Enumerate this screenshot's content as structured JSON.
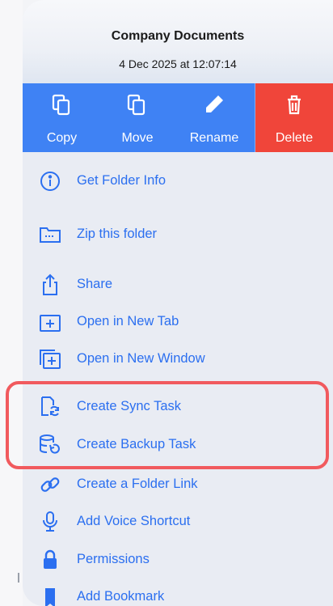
{
  "header": {
    "title": "Company Documents",
    "subtitle": "4 Dec 2025 at 12:07:14"
  },
  "actions": [
    {
      "label": "Copy",
      "icon": "copy-icon"
    },
    {
      "label": "Move",
      "icon": "move-icon"
    },
    {
      "label": "Rename",
      "icon": "pencil-icon"
    },
    {
      "label": "Delete",
      "icon": "trash-icon"
    }
  ],
  "menu_items": [
    {
      "label": "Get Folder Info",
      "icon": "info-icon"
    },
    {
      "label": "Zip this folder",
      "icon": "zip-folder-icon"
    },
    {
      "label": "Share",
      "icon": "share-icon"
    },
    {
      "label": "Open in New Tab",
      "icon": "new-tab-icon"
    },
    {
      "label": "Open in New Window",
      "icon": "new-window-icon"
    },
    {
      "label": "Create Sync Task",
      "icon": "sync-task-icon"
    },
    {
      "label": "Create Backup Task",
      "icon": "backup-task-icon"
    },
    {
      "label": "Create a Folder Link",
      "icon": "link-icon"
    },
    {
      "label": "Add Voice Shortcut",
      "icon": "microphone-icon"
    },
    {
      "label": "Permissions",
      "icon": "lock-icon"
    },
    {
      "label": "Add Bookmark",
      "icon": "bookmark-icon"
    }
  ],
  "colors": {
    "accent": "#2b6ff0",
    "action_bar": "#3f82f4",
    "delete": "#f0453a",
    "highlight": "#f15a5e"
  }
}
